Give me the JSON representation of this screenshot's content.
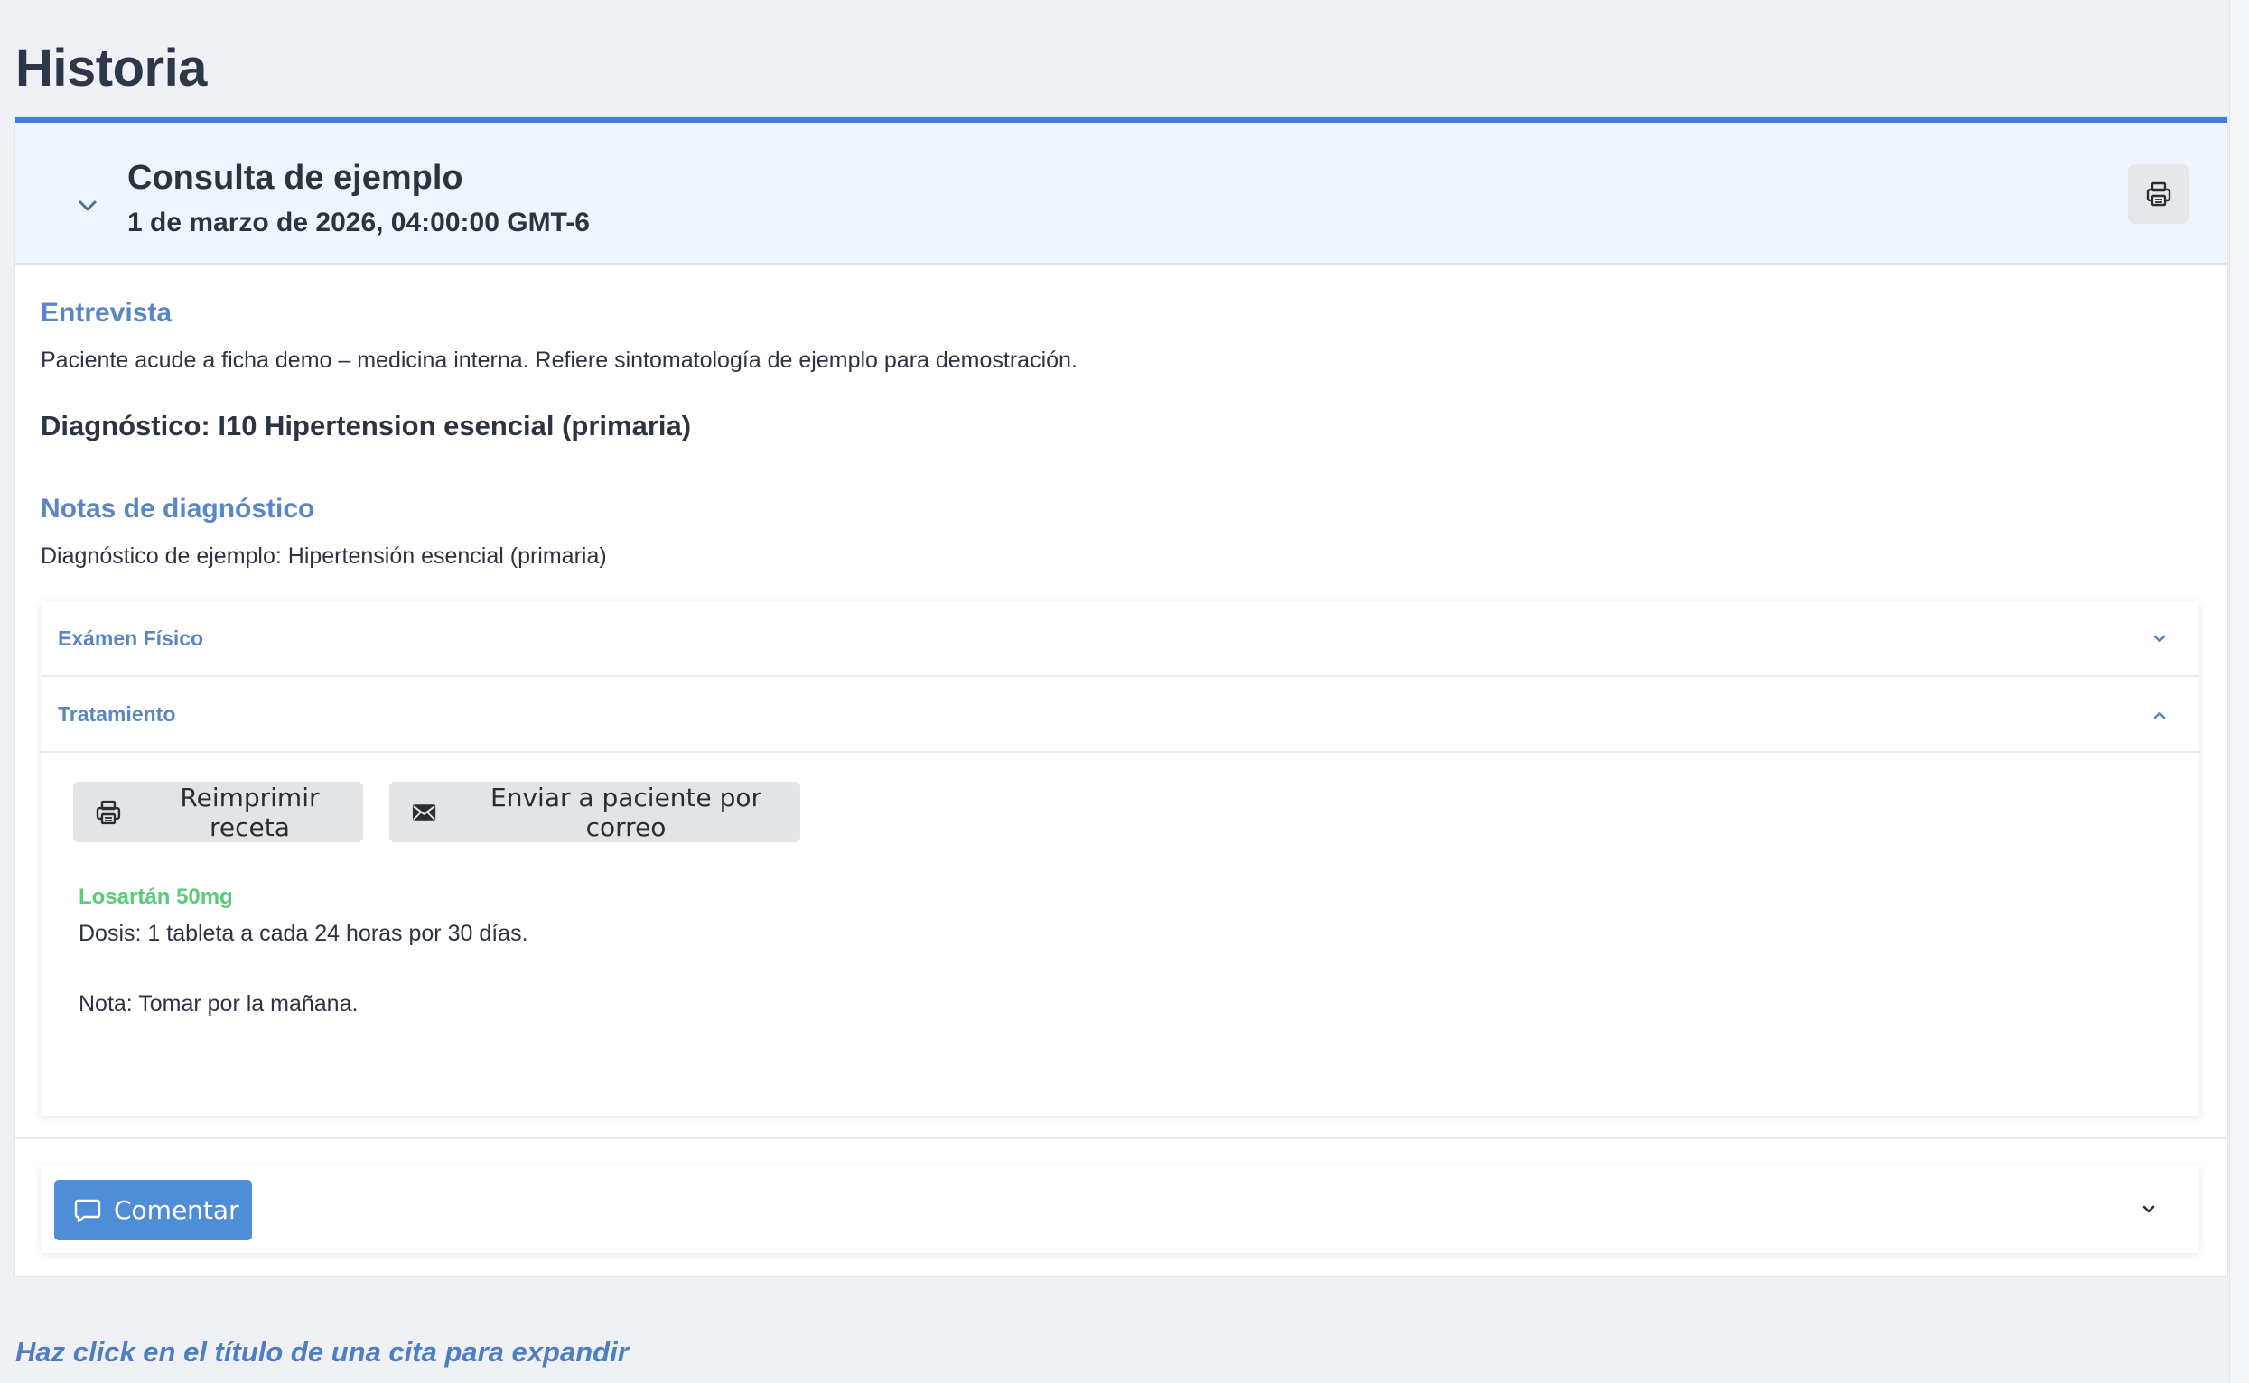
{
  "page": {
    "title": "Historia",
    "hint": "Haz click en el título de una cita para expandir"
  },
  "consultation": {
    "title": "Consulta de ejemplo",
    "date": "1 de marzo de 2026, 04:00:00 GMT-6",
    "expanded": true,
    "interview_heading": "Entrevista",
    "interview_text": "Paciente acude a ficha demo – medicina interna. Refiere sintomatología de ejemplo para demostración.",
    "diagnosis": "Diagnóstico: I10 Hipertension esencial (primaria)",
    "diagnosis_notes_heading": "Notas de diagnóstico",
    "diagnosis_notes_text": "Diagnóstico de ejemplo: Hipertensión esencial (primaria)",
    "print_icon": "printer-icon"
  },
  "accordion": {
    "physical_exam": {
      "label": "Exámen Físico",
      "expanded": false,
      "icon": "chevron-down-icon"
    },
    "treatment": {
      "label": "Tratamiento",
      "expanded": true,
      "icon": "chevron-up-icon"
    }
  },
  "treatment": {
    "reprint_label": "Reimprimir receta",
    "email_label": "Enviar a paciente por correo",
    "medication": {
      "name": "Losartán 50mg",
      "dose": "Dosis: 1 tableta a cada 24 horas por 30 días.",
      "note": "Nota: Tomar por la mañana."
    }
  },
  "comment": {
    "button_label": "Comentar",
    "icon": "chat-bubble-icon"
  },
  "colors": {
    "accent": "#3c7fd8",
    "heading_blue": "#5a86c2",
    "medication_green": "#5dc97a",
    "button_blue": "#4f8ed6",
    "header_bg": "#eef5fd",
    "page_bg": "#eff1f5"
  }
}
